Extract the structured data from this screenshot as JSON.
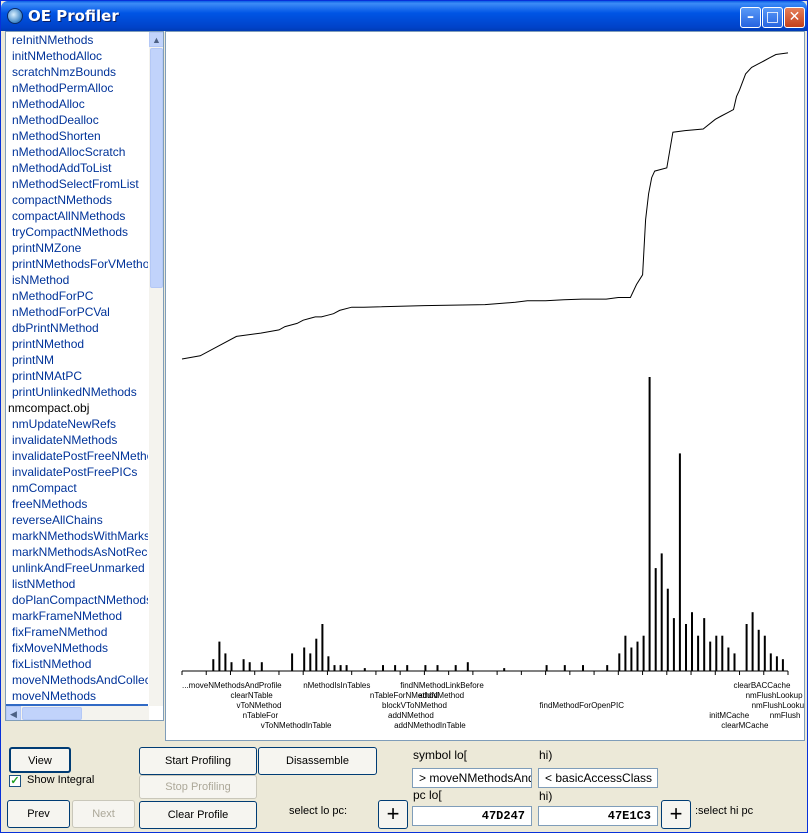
{
  "window": {
    "title": "OE Profiler",
    "min_icon": "minimize-icon",
    "max_icon": "maximize-icon",
    "close_icon": "close-icon"
  },
  "sidebar": {
    "items": [
      "reInitNMethods",
      "initNMethodAlloc",
      "scratchNmzBounds",
      "nMethodPermAlloc",
      "nMethodAlloc",
      "nMethodDealloc",
      "nMethodShorten",
      "nMethodAllocScratch",
      "nMethodAddToList",
      "nMethodSelectFromList",
      "compactNMethods",
      "compactAllNMethods",
      "tryCompactNMethods",
      "printNMZone",
      "printNMethodsForVMethod",
      "isNMethod",
      "nMethodForPC",
      "nMethodForPCVal",
      "dbPrintNMethod",
      "printNMethod",
      "printNM",
      "printNMAtPC",
      "printUnlinkedNMethods",
      "nmcompact.obj",
      "nmUpdateNewRefs",
      "invalidateNMethods",
      "invalidatePostFreeNMethods",
      "invalidatePostFreePICs",
      "nmCompact",
      "freeNMethods",
      "reverseAllChains",
      "markNMethodsWithMarks",
      "markNMethodsAsNotRecent",
      "unlinkAndFreeUnmarked",
      "listNMethod",
      "doPlanCompactNMethods",
      "markFrameNMethod",
      "fixFrameNMethod",
      "fixMoveNMethods",
      "fixListNMethod",
      "moveNMethodsAndCollect",
      "moveNMethods",
      "moveNMethodsAndProfile"
    ],
    "top_item_index": 23,
    "selected_index": 42
  },
  "chart_data": {
    "type": "line",
    "title": "",
    "xlabel": "",
    "ylabel": "",
    "x_range": [
      0,
      100
    ],
    "integral_ylim": [
      0,
      100
    ],
    "series": [
      {
        "name": "",
        "kind": "integral",
        "points": [
          [
            0,
            4
          ],
          [
            3,
            5
          ],
          [
            6,
            8
          ],
          [
            9,
            11
          ],
          [
            13,
            12
          ],
          [
            16,
            13
          ],
          [
            17,
            14
          ],
          [
            18,
            14.5
          ],
          [
            19,
            15
          ],
          [
            20,
            16
          ],
          [
            21,
            16.5
          ],
          [
            22,
            17
          ],
          [
            23,
            17
          ],
          [
            24,
            17.5
          ],
          [
            25,
            18
          ],
          [
            26,
            19
          ],
          [
            28,
            20
          ],
          [
            30,
            20
          ],
          [
            40,
            20.5
          ],
          [
            50,
            20.8
          ],
          [
            55,
            21.5
          ],
          [
            57,
            22
          ],
          [
            60,
            22
          ],
          [
            63,
            22.3
          ],
          [
            66,
            22.5
          ],
          [
            70,
            22.5
          ],
          [
            72,
            23
          ],
          [
            74,
            23
          ],
          [
            75,
            27
          ],
          [
            76,
            30
          ],
          [
            76.5,
            47
          ],
          [
            77,
            55
          ],
          [
            77.5,
            60
          ],
          [
            78,
            62
          ],
          [
            80,
            63
          ],
          [
            81,
            74
          ],
          [
            83,
            74.5
          ],
          [
            86,
            75
          ],
          [
            88,
            78
          ],
          [
            89,
            79
          ],
          [
            90,
            80
          ],
          [
            91,
            81
          ],
          [
            91.5,
            85
          ],
          [
            92,
            87
          ],
          [
            93,
            92
          ],
          [
            94,
            94
          ],
          [
            95,
            95
          ],
          [
            96,
            96
          ],
          [
            97,
            97
          ],
          [
            98,
            98
          ],
          [
            100,
            98.5
          ]
        ]
      },
      {
        "name": "",
        "kind": "histogram",
        "bars": [
          [
            5,
            4
          ],
          [
            6,
            10
          ],
          [
            7,
            6
          ],
          [
            8,
            3
          ],
          [
            10,
            4
          ],
          [
            11,
            3
          ],
          [
            13,
            3
          ],
          [
            18,
            6
          ],
          [
            20,
            8
          ],
          [
            21,
            6
          ],
          [
            22,
            11
          ],
          [
            23,
            16
          ],
          [
            24,
            5
          ],
          [
            25,
            2
          ],
          [
            26,
            2
          ],
          [
            27,
            2
          ],
          [
            30,
            1
          ],
          [
            33,
            2
          ],
          [
            35,
            2
          ],
          [
            37,
            2
          ],
          [
            40,
            2
          ],
          [
            42,
            2
          ],
          [
            45,
            2
          ],
          [
            47,
            3
          ],
          [
            53,
            1
          ],
          [
            60,
            2
          ],
          [
            63,
            2
          ],
          [
            66,
            2
          ],
          [
            70,
            2
          ],
          [
            72,
            6
          ],
          [
            73,
            12
          ],
          [
            74,
            8
          ],
          [
            75,
            10
          ],
          [
            76,
            12
          ],
          [
            77,
            100
          ],
          [
            78,
            35
          ],
          [
            79,
            40
          ],
          [
            80,
            28
          ],
          [
            81,
            18
          ],
          [
            82,
            74
          ],
          [
            83,
            16
          ],
          [
            84,
            20
          ],
          [
            85,
            12
          ],
          [
            86,
            18
          ],
          [
            87,
            10
          ],
          [
            88,
            12
          ],
          [
            89,
            12
          ],
          [
            90,
            8
          ],
          [
            91,
            6
          ],
          [
            93,
            16
          ],
          [
            94,
            20
          ],
          [
            95,
            14
          ],
          [
            96,
            12
          ],
          [
            97,
            6
          ],
          [
            98,
            5
          ],
          [
            99,
            4
          ]
        ]
      }
    ],
    "symbol_labels": [
      {
        "text": "...moveNMethodsAndProfile",
        "x": 0,
        "row": 0
      },
      {
        "text": "clearNTable",
        "x": 8,
        "row": 1
      },
      {
        "text": "vToNMethod",
        "x": 9,
        "row": 2
      },
      {
        "text": "nTableFor",
        "x": 10,
        "row": 3
      },
      {
        "text": "vToNMethodInTable",
        "x": 13,
        "row": 4
      },
      {
        "text": "nMethodIsInTables",
        "x": 20,
        "row": 0
      },
      {
        "text": "nTableForNMethod",
        "x": 31,
        "row": 1
      },
      {
        "text": "blockVToNMethod",
        "x": 33,
        "row": 2
      },
      {
        "text": "addNMethod",
        "x": 34,
        "row": 3
      },
      {
        "text": "addNMethodInTable",
        "x": 35,
        "row": 4
      },
      {
        "text": "findNMethodLinkBefore",
        "x": 36,
        "row": 0
      },
      {
        "text": "addNMethod",
        "x": 39,
        "row": 1
      },
      {
        "text": "findMethodForOpenPIC",
        "x": 59,
        "row": 2
      },
      {
        "text": "clearBACCache",
        "x": 91,
        "row": 0
      },
      {
        "text": "nmFlushLookup",
        "x": 93,
        "row": 1
      },
      {
        "text": "nmFlushLookup",
        "x": 94,
        "row": 2
      },
      {
        "text": "initMCache",
        "x": 87,
        "row": 3
      },
      {
        "text": "nmFlush",
        "x": 97,
        "row": 3
      },
      {
        "text": "clearMCache",
        "x": 89,
        "row": 4
      }
    ]
  },
  "controls": {
    "view_button": "View",
    "show_integral_label": "Show Integral",
    "show_integral_checked": true,
    "prev_button": "Prev",
    "next_button": "Next",
    "start_profiling_button": "Start Profiling",
    "stop_profiling_button": "Stop Profiling",
    "clear_profile_button": "Clear Profile",
    "disassemble_button": "Disassemble",
    "symbol_lo_label": "symbol lo[",
    "hi_label_top": "hi)",
    "symbol_lo_value": "> moveNMethodsAndProfile",
    "symbol_hi_value": "< basicAccessClass",
    "pc_lo_label": "pc lo[",
    "hi_label_bottom": "hi)",
    "pc_lo_value": "47D247",
    "pc_hi_value": "47E1C3",
    "select_lo_pc_label": "select lo pc:",
    "select_hi_pc_label": ":select hi pc",
    "plus_symbol": "+"
  }
}
